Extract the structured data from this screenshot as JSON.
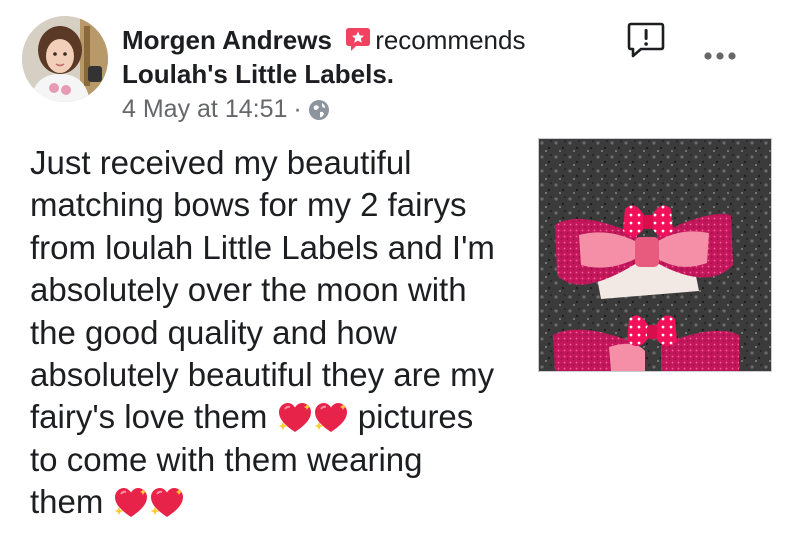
{
  "post": {
    "author": "Morgen Andrews",
    "action": "recommends",
    "page_name": "Loulah's Little Labels.",
    "date": "4 May at 14:51",
    "separator": "·",
    "privacy_icon": "globe-icon",
    "text_lines": [
      "Just received my beautiful",
      "matching bows for my 2 fairys",
      "from loulah Little Labels and I'm",
      "absolutely over the moon with",
      "the good quality and how",
      "absolutely beautiful they are my",
      "fairy's love them",
      "pictures",
      "to come with them wearing",
      "them"
    ],
    "emoji": "sparkling-heart-icon"
  },
  "colors": {
    "recommend_badge": "#f3425f",
    "meta_text": "#65676b",
    "text": "#1c1e21"
  },
  "icons": {
    "report": "report-icon",
    "more": "more-options-icon"
  }
}
